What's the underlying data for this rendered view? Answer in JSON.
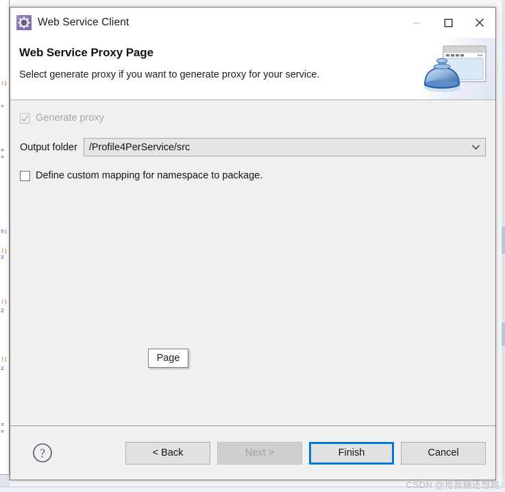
{
  "window": {
    "title": "Web Service Client",
    "icon": "gear-icon",
    "controls": {
      "minimize": "minimize-icon",
      "maximize": "maximize-icon",
      "close": "close-icon",
      "minimize_disabled": true
    }
  },
  "header": {
    "title": "Web Service Proxy Page",
    "subtitle": "Select generate proxy if you want to generate proxy for your service.",
    "banner_icon": "web-service-banner-icon"
  },
  "form": {
    "generate_proxy": {
      "label": "Generate proxy",
      "checked": true,
      "enabled": false
    },
    "output_folder": {
      "label": "Output folder",
      "value": "/Profile4PerService/src",
      "dropdown_icon": "chevron-down-icon"
    },
    "custom_mapping": {
      "label": "Define custom mapping for namespace to package.",
      "checked": false,
      "enabled": true
    }
  },
  "overlay": {
    "page_chip": "Page"
  },
  "footer": {
    "help_icon": "help-question-icon",
    "buttons": [
      {
        "label": "< Back",
        "state": "enabled"
      },
      {
        "label": "Next >",
        "state": "disabled"
      },
      {
        "label": "Finish",
        "state": "focused"
      },
      {
        "label": "Cancel",
        "state": "enabled"
      }
    ]
  },
  "watermark": {
    "text": "CSDN @抢我糖还想跑"
  },
  "colors": {
    "accent_focus": "#0078d7",
    "dialog_bg": "#f0f0f0",
    "title_icon": "#8672ad",
    "banner_blue": "#2f5fa8"
  }
}
